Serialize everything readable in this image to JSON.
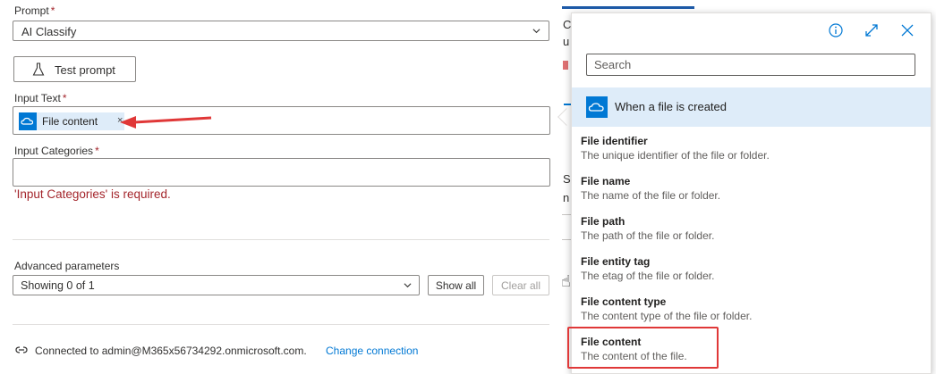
{
  "form": {
    "prompt_label": "Prompt",
    "prompt_required": "*",
    "prompt_value": "AI Classify",
    "test_button_label": "Test prompt",
    "input_text_label": "Input Text",
    "input_text_required": "*",
    "input_token_label": "File content",
    "input_token_remove": "×",
    "input_categories_label": "Input Categories",
    "input_categories_required": "*",
    "error_message": "'Input Categories' is required.",
    "advanced_label": "Advanced parameters",
    "advanced_value": "Showing 0 of 1",
    "show_all_label": "Show all",
    "clear_all_label": "Clear all",
    "connection_text": "Connected to admin@M365x56734292.onmicrosoft.com.",
    "change_connection_label": "Change connection"
  },
  "background": {
    "fragment_1": "C",
    "fragment_2": "u",
    "fragment_3": "S",
    "fragment_4": "n"
  },
  "popup": {
    "search_placeholder": "Search",
    "section_title": "When a file is created",
    "items": [
      {
        "title": "File identifier",
        "desc": "The unique identifier of the file or folder."
      },
      {
        "title": "File name",
        "desc": "The name of the file or folder."
      },
      {
        "title": "File path",
        "desc": "The path of the file or folder."
      },
      {
        "title": "File entity tag",
        "desc": "The etag of the file or folder."
      },
      {
        "title": "File content type",
        "desc": "The content type of the file or folder."
      },
      {
        "title": "File content",
        "desc": "The content of the file."
      }
    ]
  },
  "colors": {
    "accent": "#0078d4",
    "error": "#a4262c",
    "annotation": "#e03838",
    "token_bg": "#deecf9"
  },
  "icons": [
    "chevron-down-icon",
    "flask-icon",
    "cloud-icon",
    "info-icon",
    "expand-icon",
    "close-icon",
    "link-icon",
    "hand-cursor-icon"
  ]
}
